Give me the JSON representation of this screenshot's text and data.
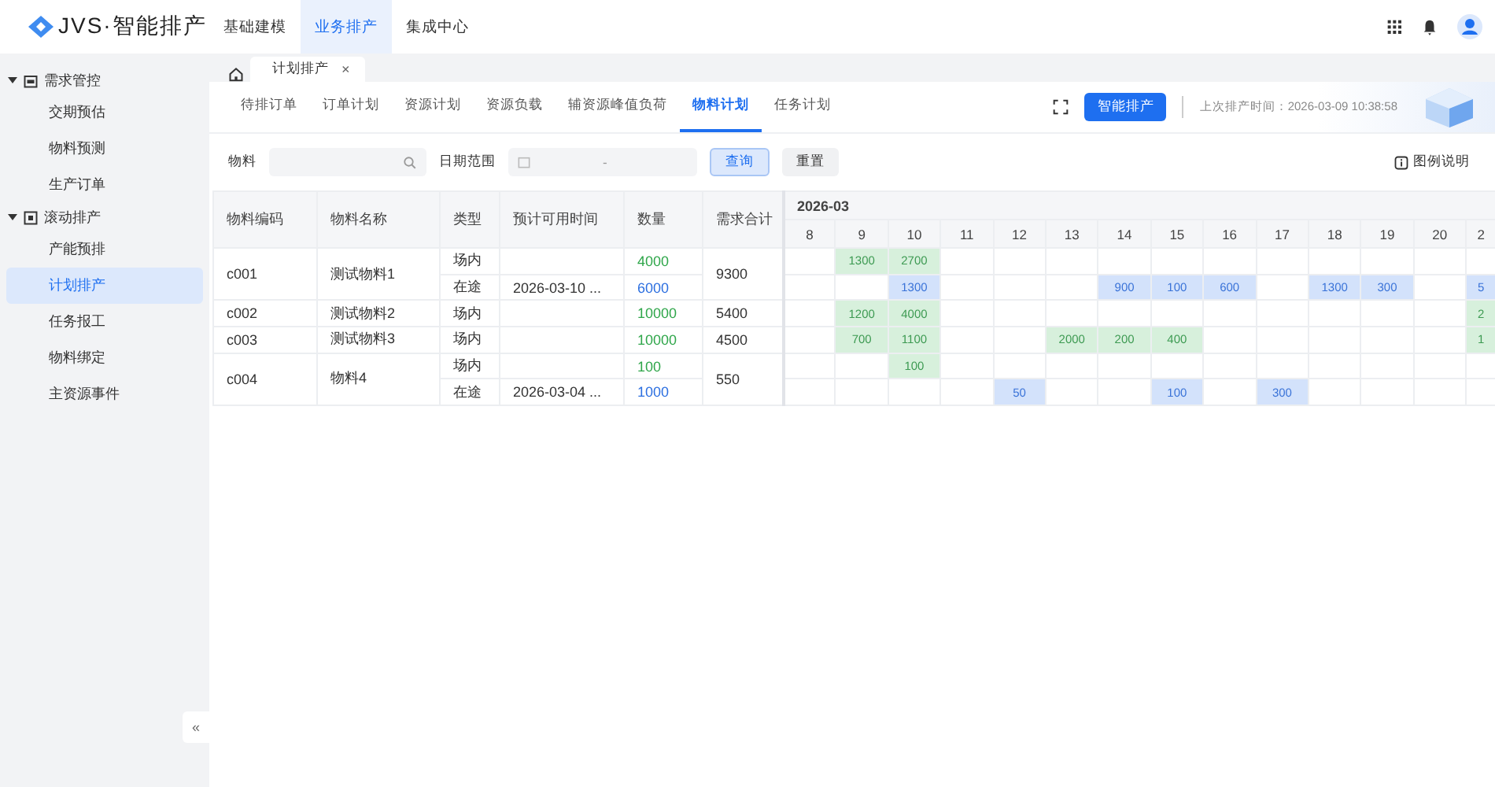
{
  "app": {
    "logo_text": "JVS·智能排产"
  },
  "top_nav": [
    {
      "label": "基础建模",
      "selected": false
    },
    {
      "label": "业务排产",
      "selected": true
    },
    {
      "label": "集成中心",
      "selected": false
    }
  ],
  "sidebar": [
    {
      "label": "需求管控",
      "expanded": true,
      "children": [
        {
          "label": "交期预估",
          "selected": false
        },
        {
          "label": "物料预测",
          "selected": false
        },
        {
          "label": "生产订单",
          "selected": false
        }
      ]
    },
    {
      "label": "滚动排产",
      "expanded": true,
      "children": [
        {
          "label": "产能预排",
          "selected": false
        },
        {
          "label": "计划排产",
          "selected": true
        },
        {
          "label": "任务报工",
          "selected": false
        },
        {
          "label": "物料绑定",
          "selected": false
        },
        {
          "label": "主资源事件",
          "selected": false
        }
      ]
    }
  ],
  "collapse_button": "«",
  "page_tabs": [
    {
      "label": "计划排产",
      "close": "×"
    }
  ],
  "sub_tabs": [
    {
      "label": "待排订单",
      "selected": false
    },
    {
      "label": "订单计划",
      "selected": false
    },
    {
      "label": "资源计划",
      "selected": false
    },
    {
      "label": "资源负载",
      "selected": false
    },
    {
      "label": "辅资源峰值负荷",
      "selected": false
    },
    {
      "label": "物料计划",
      "selected": true
    },
    {
      "label": "任务计划",
      "selected": false
    }
  ],
  "schedule_button": "智能排产",
  "last_run": "上次排产时间：2026-03-09 10:38:58",
  "filters": {
    "material_label": "物料",
    "date_label": "日期范围",
    "date_separator": "-",
    "query_button": "查询",
    "reset_button": "重置",
    "legend_link": "图例说明"
  },
  "table": {
    "columns": [
      "物料编码",
      "物料名称",
      "类型",
      "预计可用时间",
      "数量",
      "需求合计"
    ],
    "month": "2026-03",
    "days": [
      "8",
      "9",
      "10",
      "11",
      "12",
      "13",
      "14",
      "15",
      "16",
      "17",
      "18",
      "19",
      "20",
      "2"
    ],
    "materials": [
      {
        "code": "c001",
        "name": "测试物料1",
        "total": "9300",
        "lines": [
          {
            "kind": "onsite",
            "type": "场内",
            "qty": "4000",
            "cells": [
              null,
              "1300",
              "2700",
              null,
              null,
              null,
              null,
              null,
              null,
              null,
              null,
              null,
              null,
              null
            ]
          },
          {
            "kind": "transit",
            "type": "在途",
            "date": "2026-03-10 ...",
            "qty": "6000",
            "cells": [
              null,
              null,
              "1300",
              null,
              null,
              null,
              "900",
              "100",
              "600",
              null,
              "1300",
              "300",
              null,
              "5"
            ]
          }
        ]
      },
      {
        "code": "c002",
        "name": "测试物料2",
        "total": "5400",
        "lines": [
          {
            "kind": "onsite",
            "type": "场内",
            "qty": "10000",
            "cells": [
              null,
              "1200",
              "4000",
              null,
              null,
              null,
              null,
              null,
              null,
              null,
              null,
              null,
              null,
              "2"
            ]
          }
        ]
      },
      {
        "code": "c003",
        "name": "测试物料3",
        "total": "4500",
        "lines": [
          {
            "kind": "onsite",
            "type": "场内",
            "qty": "10000",
            "cells": [
              null,
              "700",
              "1100",
              null,
              null,
              "2000",
              "200",
              "400",
              null,
              null,
              null,
              null,
              null,
              "1"
            ]
          }
        ]
      },
      {
        "code": "c004",
        "name": "物料4",
        "total": "550",
        "lines": [
          {
            "kind": "onsite",
            "type": "场内",
            "qty": "100",
            "cells": [
              null,
              null,
              "100",
              null,
              null,
              null,
              null,
              null,
              null,
              null,
              null,
              null,
              null,
              null
            ]
          },
          {
            "kind": "transit",
            "type": "在途",
            "date": "2026-03-04 ...",
            "qty": "1000",
            "cells": [
              null,
              null,
              null,
              null,
              "50",
              null,
              null,
              "100",
              null,
              "300",
              null,
              null,
              null,
              null
            ]
          }
        ]
      }
    ]
  }
}
